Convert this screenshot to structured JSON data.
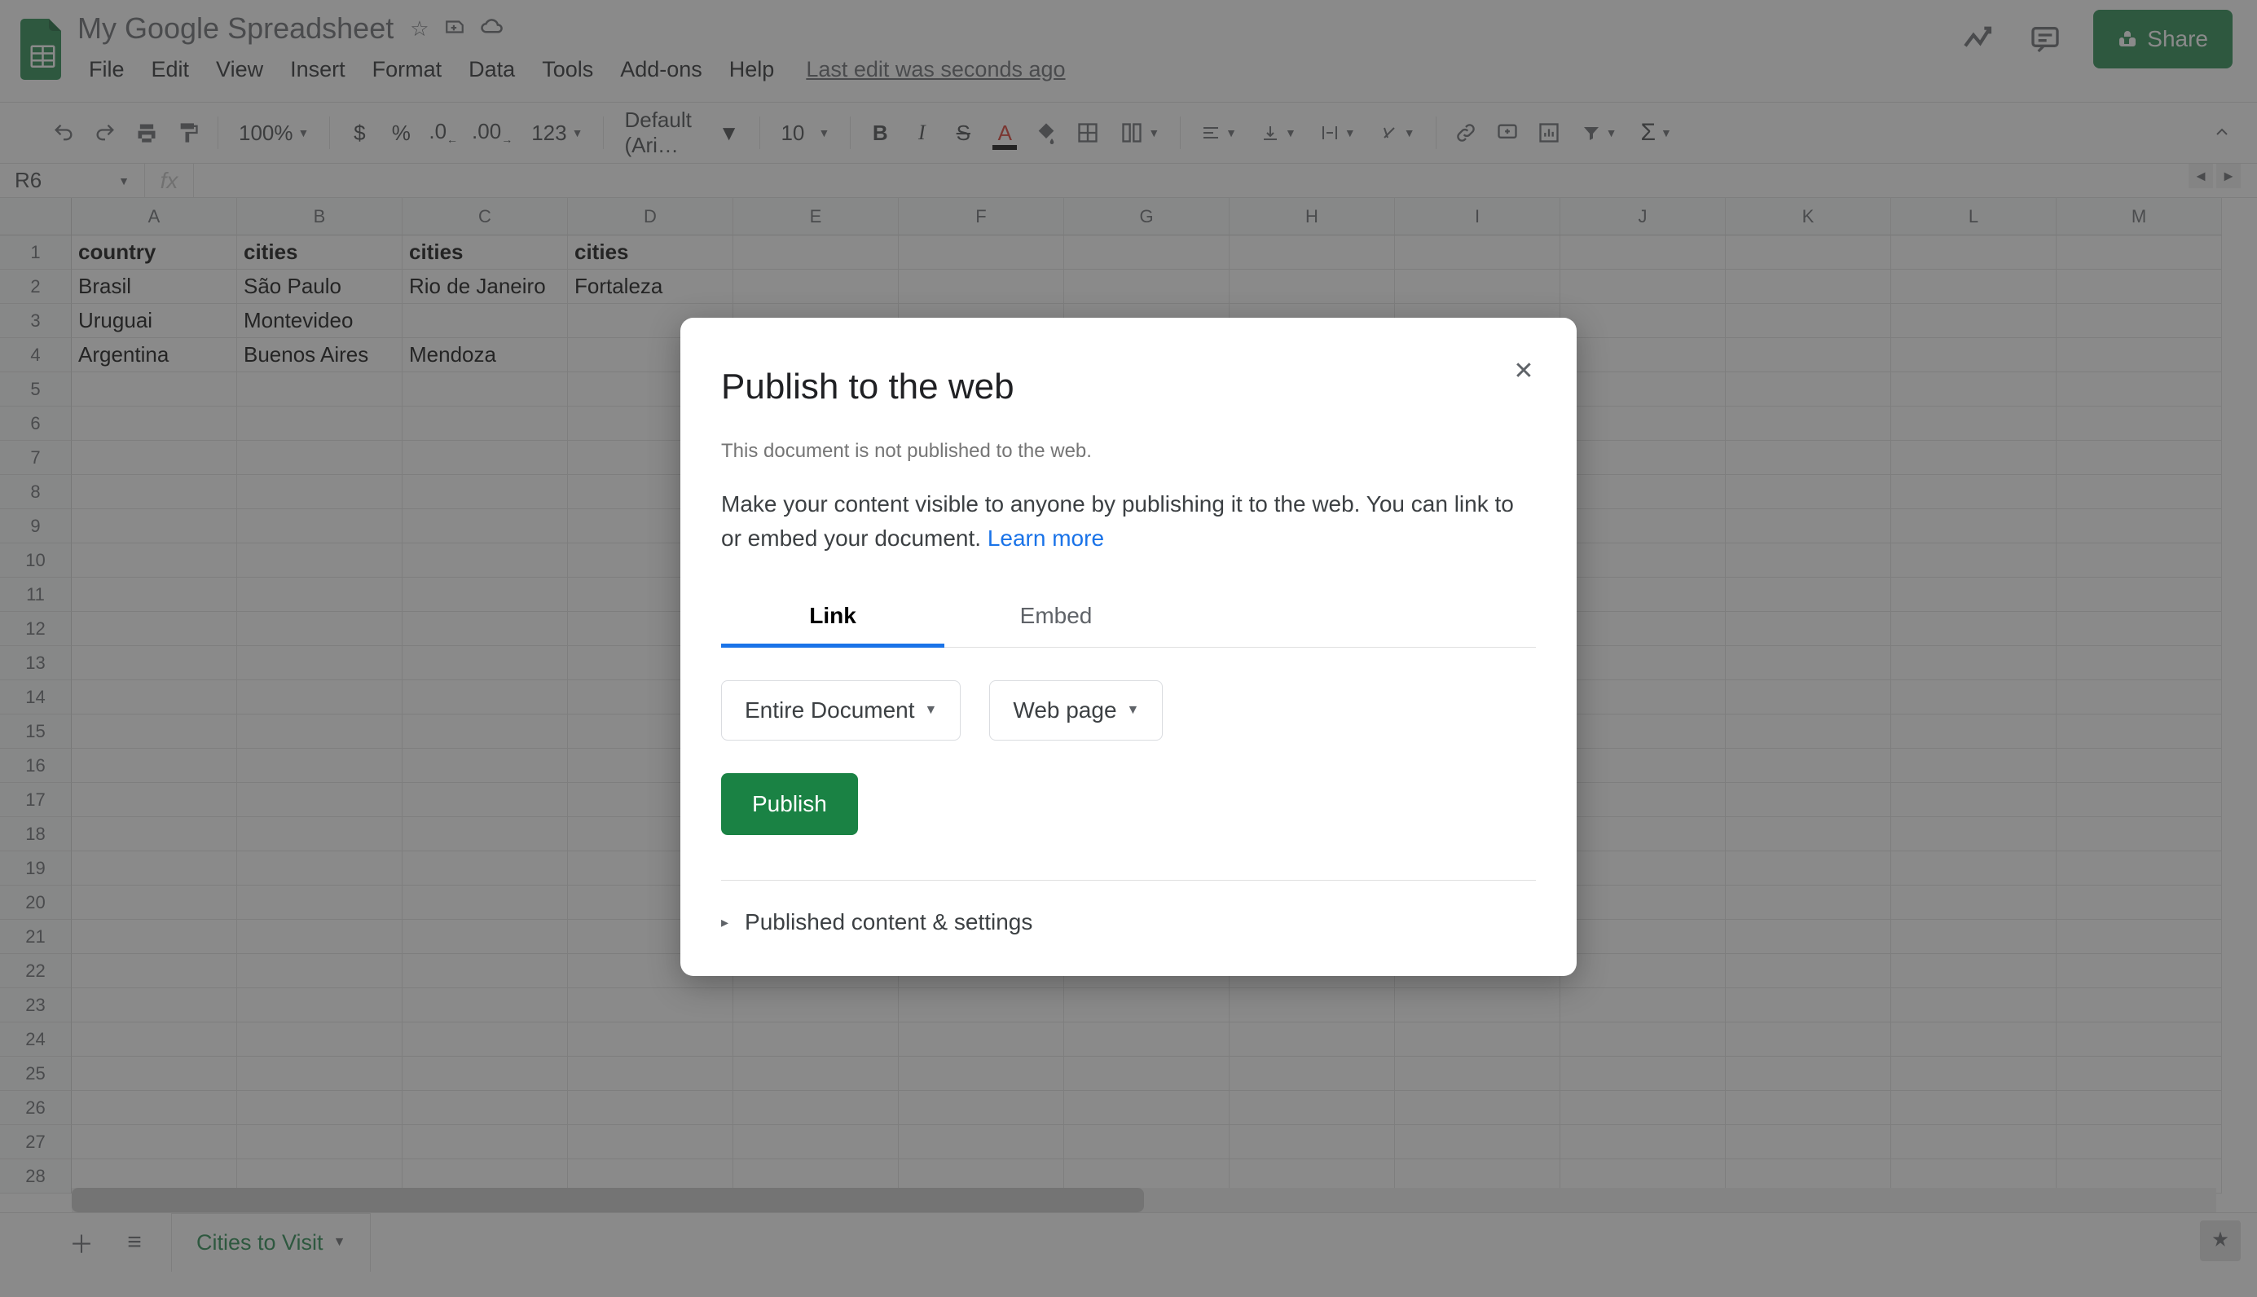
{
  "header": {
    "title": "My Google Spreadsheet",
    "menus": [
      "File",
      "Edit",
      "View",
      "Insert",
      "Format",
      "Data",
      "Tools",
      "Add-ons",
      "Help"
    ],
    "last_edit": "Last edit was seconds ago",
    "share_label": "Share"
  },
  "toolbar": {
    "zoom": "100%",
    "number_format": "123",
    "font": "Default (Ari…",
    "font_size": "10"
  },
  "fx": {
    "name_box": "R6",
    "fx_label": "fx",
    "formula": ""
  },
  "grid": {
    "columns": [
      "A",
      "B",
      "C",
      "D",
      "E",
      "F",
      "G",
      "H",
      "I",
      "J",
      "K",
      "L",
      "M"
    ],
    "row_count": 28,
    "data": [
      [
        "country",
        "cities",
        "cities",
        "cities",
        "",
        "",
        "",
        "",
        "",
        "",
        "",
        "",
        ""
      ],
      [
        "Brasil",
        "São Paulo",
        "Rio de Janeiro",
        "Fortaleza",
        "",
        "",
        "",
        "",
        "",
        "",
        "",
        "",
        ""
      ],
      [
        "Uruguai",
        "Montevideo",
        "",
        "",
        "",
        "",
        "",
        "",
        "",
        "",
        "",
        "",
        ""
      ],
      [
        "Argentina",
        "Buenos Aires",
        "Mendoza",
        "",
        "",
        "",
        "",
        "",
        "",
        "",
        "",
        "",
        ""
      ]
    ],
    "header_row_index": 0
  },
  "sheet_bar": {
    "active_tab": "Cities to Visit"
  },
  "dialog": {
    "title": "Publish to the web",
    "status_note": "This document is not published to the web.",
    "description": "Make your content visible to anyone by publishing it to the web. You can link to or embed your document. ",
    "learn_more": "Learn more",
    "tabs": {
      "link": "Link",
      "embed": "Embed"
    },
    "select_scope": "Entire Document",
    "select_format": "Web page",
    "publish_label": "Publish",
    "expand_label": "Published content & settings"
  }
}
